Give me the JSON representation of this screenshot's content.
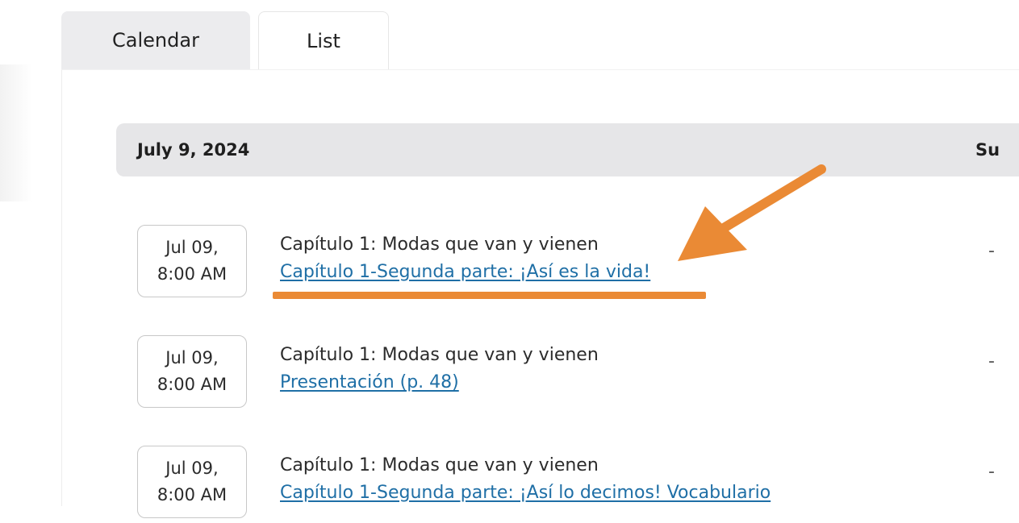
{
  "tabs": [
    {
      "label": "Calendar",
      "active": false
    },
    {
      "label": "List",
      "active": true
    }
  ],
  "day_header": {
    "date": "July 9, 2024",
    "column_label": "Su"
  },
  "events": [
    {
      "date_line1": "Jul 09,",
      "date_line2": "8:00 AM",
      "course": "Capítulo 1: Modas que van y vienen",
      "link": "Capítulo 1-Segunda parte: ¡Así es la vida!",
      "status": "-"
    },
    {
      "date_line1": "Jul 09,",
      "date_line2": "8:00 AM",
      "course": "Capítulo 1: Modas que van y vienen",
      "link": "Presentación (p. 48)",
      "status": "-"
    },
    {
      "date_line1": "Jul 09,",
      "date_line2": "8:00 AM",
      "course": "Capítulo 1: Modas que van y vienen",
      "link": "Capítulo 1-Segunda parte: ¡Así lo decimos! Vocabulario",
      "status": "-"
    }
  ],
  "colors": {
    "link": "#1f6fa6",
    "annotation": "#ea8a35",
    "header_bg": "#e6e6e8",
    "tab_inactive_bg": "#ececee"
  }
}
